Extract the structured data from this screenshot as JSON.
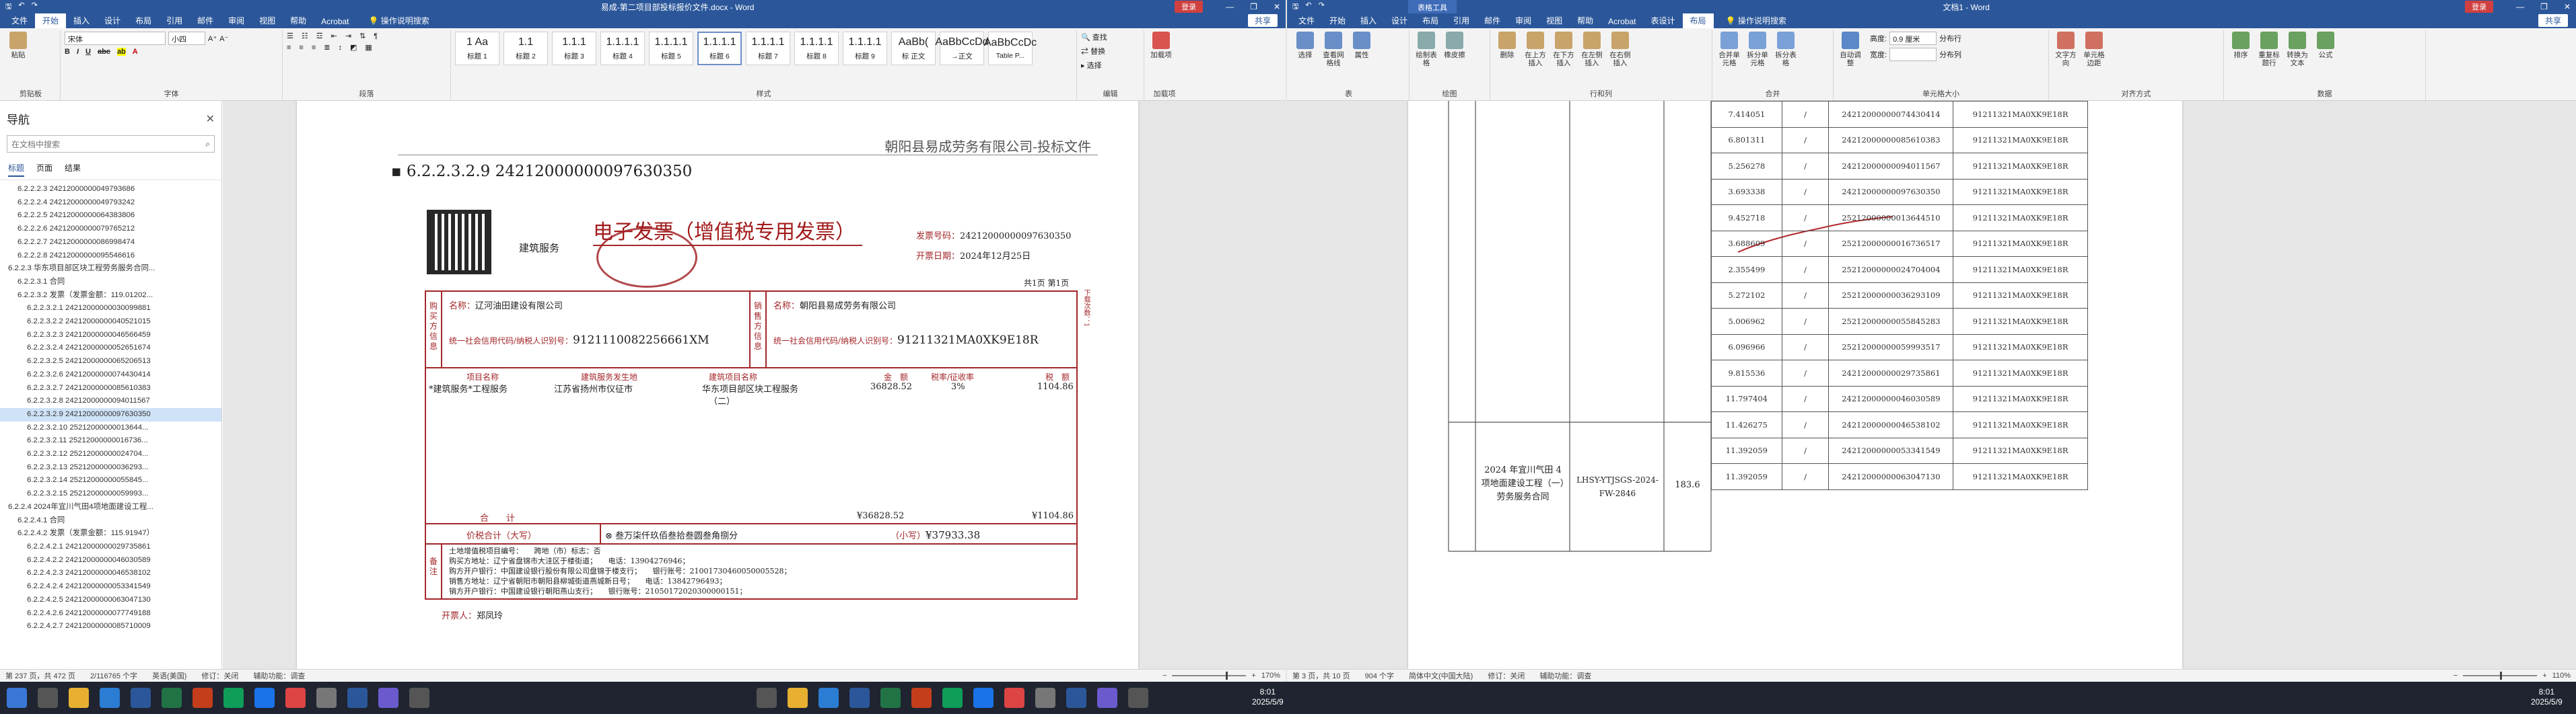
{
  "left": {
    "title": "易成-第二项目部投标报价文件.docx - Word",
    "user_label": "登录",
    "share": "共享",
    "menu": [
      "文件",
      "开始",
      "插入",
      "设计",
      "布局",
      "引用",
      "邮件",
      "审阅",
      "视图",
      "帮助",
      "Acrobat"
    ],
    "search_hint": "操作说明搜索",
    "ribbon": {
      "font_name": "宋体",
      "font_size": "小四",
      "group_labels": [
        "剪贴板",
        "字体",
        "段落",
        "样式",
        "编辑",
        "加载项"
      ],
      "clipboard": "粘贴",
      "styles": [
        {
          "sample": "1 Aa",
          "name": "标题 1"
        },
        {
          "sample": "1.1",
          "name": "标题 2"
        },
        {
          "sample": "1.1.1",
          "name": "标题 3"
        },
        {
          "sample": "1.1.1.1",
          "name": "标题 4"
        },
        {
          "sample": "1.1.1.1",
          "name": "标题 5"
        },
        {
          "sample": "1.1.1.1",
          "name": "标题 6"
        },
        {
          "sample": "1.1.1.1",
          "name": "标题 7"
        },
        {
          "sample": "1.1.1.1",
          "name": "标题 8"
        },
        {
          "sample": "1.1.1.1",
          "name": "标题 9"
        },
        {
          "sample": "AaBb(",
          "name": "标 正文"
        },
        {
          "sample": "AaBbCcDd",
          "name": "→正文"
        },
        {
          "sample": "AaBbCcDc",
          "name": "Table P..."
        }
      ],
      "editing": [
        "查找",
        "替换",
        "选择"
      ],
      "addin": "加载项"
    },
    "nav": {
      "title": "导航",
      "search_placeholder": "在文档中搜索",
      "tabs": [
        "标题",
        "页面",
        "结果"
      ],
      "items": [
        "6.2.2.2.3 24212000000049793686",
        "6.2.2.2.4 24212000000049793242",
        "6.2.2.2.5 24212000000064383806",
        "6.2.2.2.6 24212000000079765212",
        "6.2.2.2.7 24212000000086998474",
        "6.2.2.2.8 24212000000095546616",
        "6.2.2.3 华东项目部区块工程劳务服务合同...",
        "6.2.2.3.1 合同",
        "6.2.2.3.2 发票（发票金额：119.01202...",
        "6.2.2.3.2.1 24212000000030099881",
        "6.2.2.3.2.2 24212000000040521015",
        "6.2.2.3.2.3 24212000000046566459",
        "6.2.2.3.2.4 24212000000052651674",
        "6.2.2.3.2.5 24212000000065206513",
        "6.2.2.3.2.6 24212000000074430414",
        "6.2.2.3.2.7 24212000000085610383",
        "6.2.2.3.2.8 24212000000094011567",
        "6.2.2.3.2.9 24212000000097630350",
        "6.2.2.3.2.10 25212000000013644...",
        "6.2.2.3.2.11 25212000000016736...",
        "6.2.2.3.2.12 25212000000024704...",
        "6.2.2.3.2.13 25212000000036293...",
        "6.2.2.3.2.14 25212000000055845...",
        "6.2.2.3.2.15 25212000000059993...",
        "6.2.2.4 2024年宜川气田4项地面建设工程...",
        "6.2.2.4.1 合同",
        "6.2.2.4.2 发票（发票金额：115.91947）",
        "6.2.2.4.2.1 24212000000029735861",
        "6.2.2.4.2.2 24212000000046030589",
        "6.2.2.4.2.3 24212000000046538102",
        "6.2.2.4.2.4 24212000000053341549",
        "6.2.2.4.2.5 24212000000063047130",
        "6.2.2.4.2.6 24212000000077749188",
        "6.2.2.4.2.7 24212000000085710009"
      ],
      "selected_index": 17
    },
    "page": {
      "header": "朝阳县易成劳务有限公司-投标文件",
      "heading": "6.2.2.3.2.9 24212000000097630350",
      "invoice": {
        "title": "电子发票（增值税专用发票）",
        "service_label": "建筑服务",
        "invoice_no_label": "发票号码：",
        "invoice_no": "24212000000097630350",
        "date_label": "开票日期：",
        "date": "2024年12月25日",
        "page_info": "共1页 第1页",
        "buyer_side": "购买方信息",
        "seller_side": "销售方信息",
        "buyer_name_label": "名称：",
        "buyer_name": "辽河油田建设有限公司",
        "buyer_tax_label": "统一社会信用代码/纳税人识别号：",
        "buyer_tax": "9121110082256661XM",
        "seller_name_label": "名称：",
        "seller_name": "朝阳县易成劳务有限公司",
        "seller_tax_label": "统一社会信用代码/纳税人识别号：",
        "seller_tax": "91211321MA0XK9E18R",
        "col_item": "项目名称",
        "col_place": "建筑服务发生地",
        "col_project": "建筑项目名称",
        "col_amount": "金　额",
        "col_rate": "税率/征收率",
        "col_tax": "税　额",
        "item": "*建筑服务*工程服务",
        "place": "江苏省扬州市仪征市",
        "project": "华东项目部区块工程服务",
        "project2": "（二）",
        "amount": "36828.52",
        "rate": "3%",
        "tax": "1104.86",
        "total_label": "合　　计",
        "total_amount": "¥36828.52",
        "total_tax": "¥1104.86",
        "grand_label": "价税合计（大写）",
        "grand_words": "叁万柒仟玖佰叁拾叁圆叁角捌分",
        "grand_small_label": "（小写）",
        "grand_small": "¥37933.38",
        "remark_side": "备注",
        "remarks": [
          "土地增值税项目编号：　　跨地（市）标志：否",
          "购买方地址：辽宁省盘锦市大洼区于楼街道；　　电话：13904276946；",
          "购方开户银行：中国建设银行股份有限公司盘锦于楼支行；　　银行账号：21001730460050005528；",
          "销售方地址：辽宁省朝阳市朝阳县柳城街道燕城新日号；　　电话：13842796493；",
          "销方开户银行：中国建设银行朝阳燕山支行；　　银行账号：21050172020300000151；"
        ],
        "issuer_label": "开票人：",
        "issuer": "郑凤玲",
        "margin_note": "下载次数：1"
      }
    },
    "status": {
      "page": "第 237 页，共 472 页",
      "words": "2/116765 个字",
      "lang": "英语(美国)",
      "track": "修订：关闭",
      "accessibility": "辅助功能：调查",
      "zoom": "170%"
    }
  },
  "right": {
    "title": "文档1 - Word",
    "context_tab": "表格工具",
    "user_label": "登录",
    "share": "共享",
    "menu": [
      "文件",
      "开始",
      "插入",
      "设计",
      "布局",
      "引用",
      "邮件",
      "审阅",
      "视图",
      "帮助",
      "Acrobat",
      "表设计",
      "布局"
    ],
    "search_hint": "操作说明搜索",
    "ribbon": {
      "groups": [
        "表",
        "绘图",
        "行和列",
        "合并",
        "单元格大小",
        "对齐方式",
        "数据"
      ],
      "buttons": [
        "选择",
        "查看网格线",
        "属性",
        "绘制表格",
        "橡皮擦",
        "删除",
        "在上方插入",
        "在下方插入",
        "在左侧插入",
        "在右侧插入",
        "合并单元格",
        "拆分单元格",
        "拆分表格",
        "自动调整",
        "文字方向",
        "单元格边距",
        "排序",
        "重复标题行",
        "转换为文本",
        "公式"
      ],
      "height_label": "高度:",
      "height_value": "0.9 厘米",
      "width_label": "宽度:",
      "dist_rows": "分布行",
      "dist_cols": "分布列"
    },
    "table": {
      "rows": [
        {
          "amount": "7.414051",
          "mark": "/",
          "invoice": "24212000000074430414",
          "tax": "91211321MA0XK9E18R"
        },
        {
          "amount": "6.801311",
          "mark": "/",
          "invoice": "24212000000085610383",
          "tax": "91211321MA0XK9E18R"
        },
        {
          "amount": "5.256278",
          "mark": "/",
          "invoice": "24212000000094011567",
          "tax": "91211321MA0XK9E18R"
        },
        {
          "amount": "3.693338",
          "mark": "/",
          "invoice": "24212000000097630350",
          "tax": "91211321MA0XK9E18R"
        },
        {
          "amount": "9.452718",
          "mark": "/",
          "invoice": "25212000000013644510",
          "tax": "91211321MA0XK9E18R"
        },
        {
          "amount": "3.688609",
          "mark": "/",
          "invoice": "25212000000016736517",
          "tax": "91211321MA0XK9E18R"
        },
        {
          "amount": "2.355499",
          "mark": "/",
          "invoice": "25212000000024704004",
          "tax": "91211321MA0XK9E18R"
        },
        {
          "amount": "5.272102",
          "mark": "/",
          "invoice": "25212000000036293109",
          "tax": "91211321MA0XK9E18R"
        },
        {
          "amount": "5.006962",
          "mark": "/",
          "invoice": "25212000000055845283",
          "tax": "91211321MA0XK9E18R"
        },
        {
          "amount": "6.096966",
          "mark": "/",
          "invoice": "25212000000059993517",
          "tax": "91211321MA0XK9E18R"
        },
        {
          "amount": "9.815536",
          "mark": "/",
          "invoice": "24212000000029735861",
          "tax": "91211321MA0XK9E18R"
        },
        {
          "amount": "11.797404",
          "mark": "/",
          "invoice": "24212000000046030589",
          "tax": "91211321MA0XK9E18R"
        },
        {
          "amount": "11.426275",
          "mark": "/",
          "invoice": "24212000000046538102",
          "tax": "91211321MA0XK9E18R"
        },
        {
          "amount": "11.392059",
          "mark": "/",
          "invoice": "24212000000053341549",
          "tax": "91211321MA0XK9E18R"
        },
        {
          "amount": "11.392059",
          "mark": "/",
          "invoice": "24212000000063047130",
          "tax": "91211321MA0XK9E18R"
        }
      ],
      "group2_name": "2024 年宜川气田 4 项地面建设工程（一）劳务服务合同",
      "group2_code": "LHSY-YTJSGS-2024-FW-2846",
      "group2_amount": "183.6"
    },
    "status": {
      "page": "第 3 页，共 10 页",
      "words": "904 个字",
      "lang": "简体中文(中国大陆)",
      "track": "修订：关闭",
      "accessibility": "辅助功能：调查",
      "zoom": "110%"
    }
  },
  "taskbar": {
    "time": "8:01",
    "date": "2025/5/9"
  },
  "colors": {
    "word_blue": "#2b579a",
    "invoice_red": "#a3272a",
    "taskbar": "#1f2430"
  }
}
